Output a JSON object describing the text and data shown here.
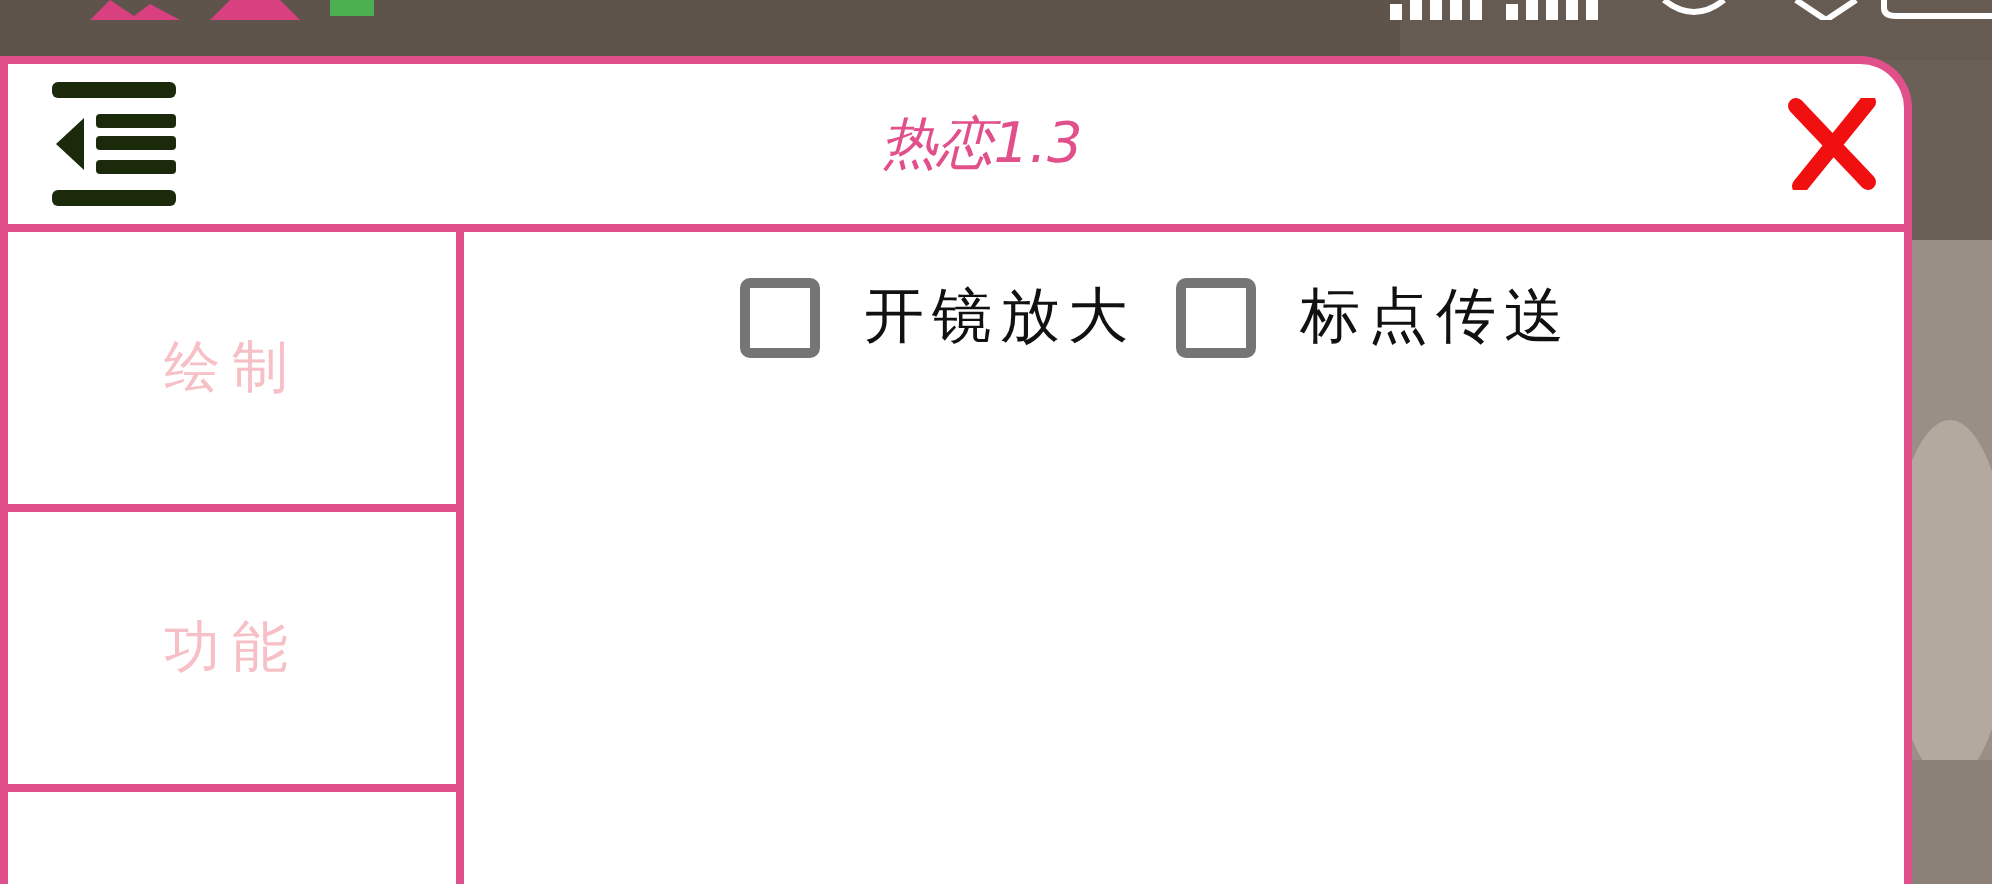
{
  "window": {
    "title": "热恋1.3"
  },
  "sidebar": {
    "items": [
      {
        "label": "绘制"
      },
      {
        "label": "功能"
      }
    ]
  },
  "options": [
    {
      "label": "开镜放大",
      "checked": false
    },
    {
      "label": "标点传送",
      "checked": false
    }
  ]
}
